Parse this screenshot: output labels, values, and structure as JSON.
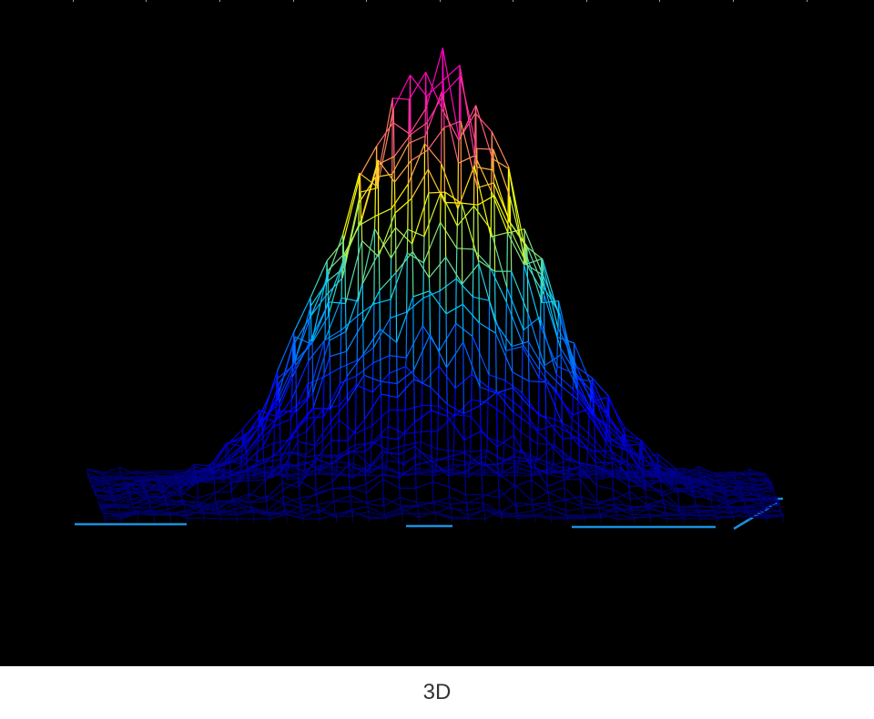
{
  "caption": "3D",
  "chart_data": {
    "type": "surface",
    "style": "wireframe",
    "title": "",
    "xlabel": "",
    "ylabel": "",
    "zlabel": "",
    "shape": "2D Gaussian peak with noise",
    "z_range": [
      0,
      1
    ],
    "peak_value": 1.0,
    "colormap": [
      "#000066",
      "#0000ff",
      "#00c8ff",
      "#ffff00",
      "#ff00c0"
    ],
    "background": "#000000",
    "axis_color": "#1a8fe0",
    "grid": false,
    "legend": "none"
  }
}
